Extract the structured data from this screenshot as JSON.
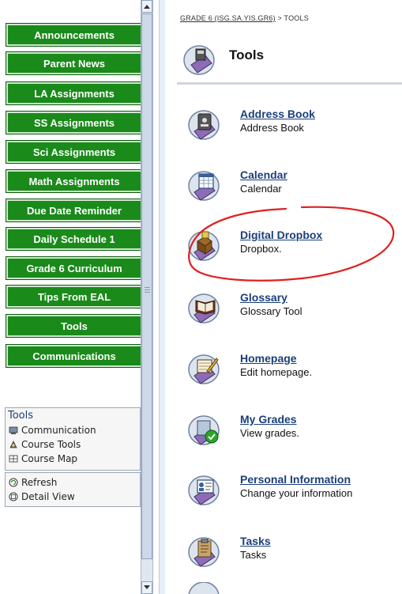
{
  "nav": {
    "buttons": [
      "Announcements",
      "Parent News",
      "LA Assignments",
      "SS Assignments",
      "Sci Assignments",
      "Math Assignments",
      "Due Date Reminder",
      "Daily Schedule 1",
      "Grade 6 Curriculum",
      "Tips From EAL",
      "Tools",
      "Communications"
    ]
  },
  "tools_panel": {
    "title": "Tools",
    "items": [
      "Communication",
      "Course Tools",
      "Course Map"
    ]
  },
  "view_panel": {
    "items": [
      "Refresh",
      "Detail View"
    ]
  },
  "breadcrumb": {
    "parent": "GRADE 6 (ISG.SA.YIS.GR6)",
    "separator": " > ",
    "current": "TOOLS"
  },
  "page": {
    "title": "Tools"
  },
  "tools": [
    {
      "name": "Address Book",
      "desc": "Address Book",
      "icon": "address-book-icon"
    },
    {
      "name": "Calendar",
      "desc": "Calendar",
      "icon": "calendar-icon"
    },
    {
      "name": "Digital Dropbox",
      "desc": "Dropbox.",
      "icon": "dropbox-icon"
    },
    {
      "name": "Glossary",
      "desc": "Glossary Tool",
      "icon": "glossary-icon"
    },
    {
      "name": "Homepage",
      "desc": "Edit homepage.",
      "icon": "homepage-icon"
    },
    {
      "name": "My Grades",
      "desc": "View grades.",
      "icon": "grades-icon"
    },
    {
      "name": "Personal Information",
      "desc": "Change your information",
      "icon": "personal-info-icon"
    },
    {
      "name": "Tasks",
      "desc": "Tasks",
      "icon": "tasks-icon"
    }
  ],
  "colors": {
    "nav_green": "#1a8a1a",
    "link_blue": "#1b3f7a",
    "annotation_red": "#e02020"
  }
}
